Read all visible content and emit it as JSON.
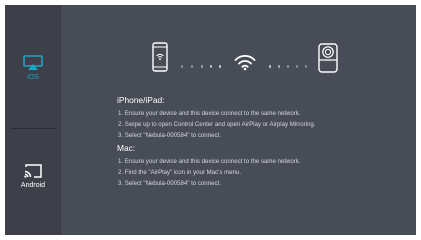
{
  "sidebar": {
    "items": [
      {
        "label": "iOS",
        "icon": "airplay-icon",
        "selected": true
      },
      {
        "label": "Android",
        "icon": "cast-icon",
        "selected": false
      }
    ]
  },
  "connection_diagram": {
    "left_icon": "iphone-wifi-icon",
    "center_icon": "wifi-icon",
    "right_icon": "projector-icon"
  },
  "instructions": {
    "iphone": {
      "heading": "iPhone/iPad:",
      "steps": [
        "1. Ensure your device and this device connect to the same network.",
        "2. Swipe up to open Control Center and open AirPlay or Airplay Mirroring.",
        "3. Select \"Nebula-000584\" to connect."
      ]
    },
    "mac": {
      "heading": "Mac:",
      "steps": [
        "1. Ensure your device and this device connect to the same network.",
        "2. Find the \"AirPlay\" icon in your Mac's menu.",
        "3. Select \"Nebula-000584\" to connect."
      ]
    }
  },
  "colors": {
    "background": "#484c56",
    "sidebar": "#3d4049",
    "accent": "#19a7c6",
    "text": "#ffffff"
  }
}
